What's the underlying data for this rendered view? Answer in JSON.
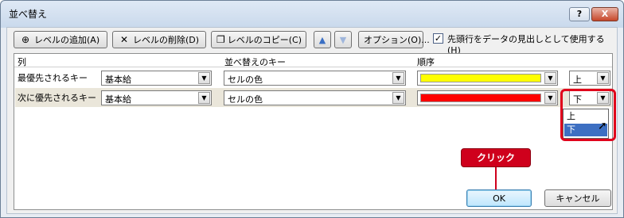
{
  "window": {
    "title": "並べ替え",
    "help_label": "?",
    "close_label": "X"
  },
  "toolbar": {
    "add_level": "レベルの追加(A)",
    "delete_level": "レベルの削除(D)",
    "copy_level": "レベルのコピー(C)",
    "move_up": "▲",
    "move_down": "▼",
    "options": "オプション(O)...",
    "header_checkbox_label": "先頭行をデータの見出しとして使用する(H)",
    "header_checked": true
  },
  "grid": {
    "headers": {
      "column": "列",
      "sort_on": "並べ替えのキー",
      "order": "順序"
    },
    "rows": [
      {
        "label": "最優先されるキー",
        "column": "基本給",
        "sort_on": "セルの色",
        "color": "#ffff00",
        "position": "上"
      },
      {
        "label": "次に優先されるキー",
        "column": "基本給",
        "sort_on": "セルの色",
        "color": "#ff0000",
        "position": "下"
      }
    ]
  },
  "dropdown": {
    "options": [
      "上",
      "下"
    ],
    "highlighted": "下"
  },
  "annotation": {
    "callout": "クリック"
  },
  "buttons": {
    "ok": "OK",
    "cancel": "キャンセル"
  }
}
